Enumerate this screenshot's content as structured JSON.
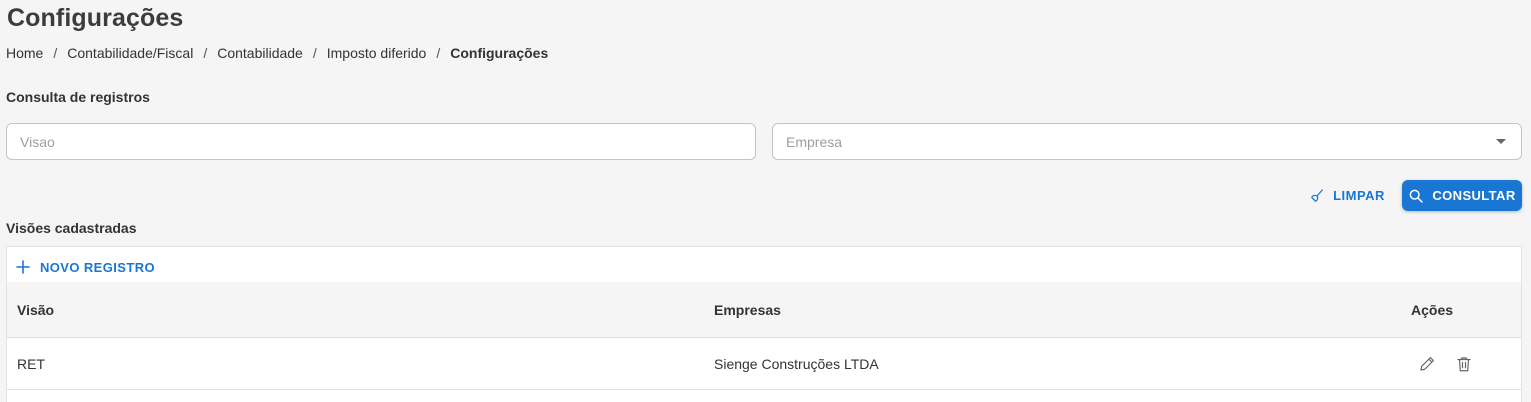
{
  "page": {
    "title": "Configurações"
  },
  "breadcrumb": {
    "items": [
      "Home",
      "Contabilidade/Fiscal",
      "Contabilidade",
      "Imposto diferido"
    ],
    "current": "Configurações",
    "separator": "/"
  },
  "query": {
    "section_label": "Consulta de registros",
    "visao_placeholder": "Visao",
    "empresa_placeholder": "Empresa",
    "clear_label": "LIMPAR",
    "search_label": "CONSULTAR"
  },
  "list": {
    "section_label": "Visões cadastradas",
    "new_label": "NOVO REGISTRO",
    "columns": {
      "visao": "Visão",
      "empresas": "Empresas",
      "acoes": "Ações"
    },
    "rows": [
      {
        "visao": "RET",
        "empresas": "Sienge Construções LTDA",
        "actions": [
          "edit-icon",
          "delete-icon"
        ]
      }
    ]
  },
  "colors": {
    "accent": "#1976d2",
    "background": "#f5f5f5"
  }
}
